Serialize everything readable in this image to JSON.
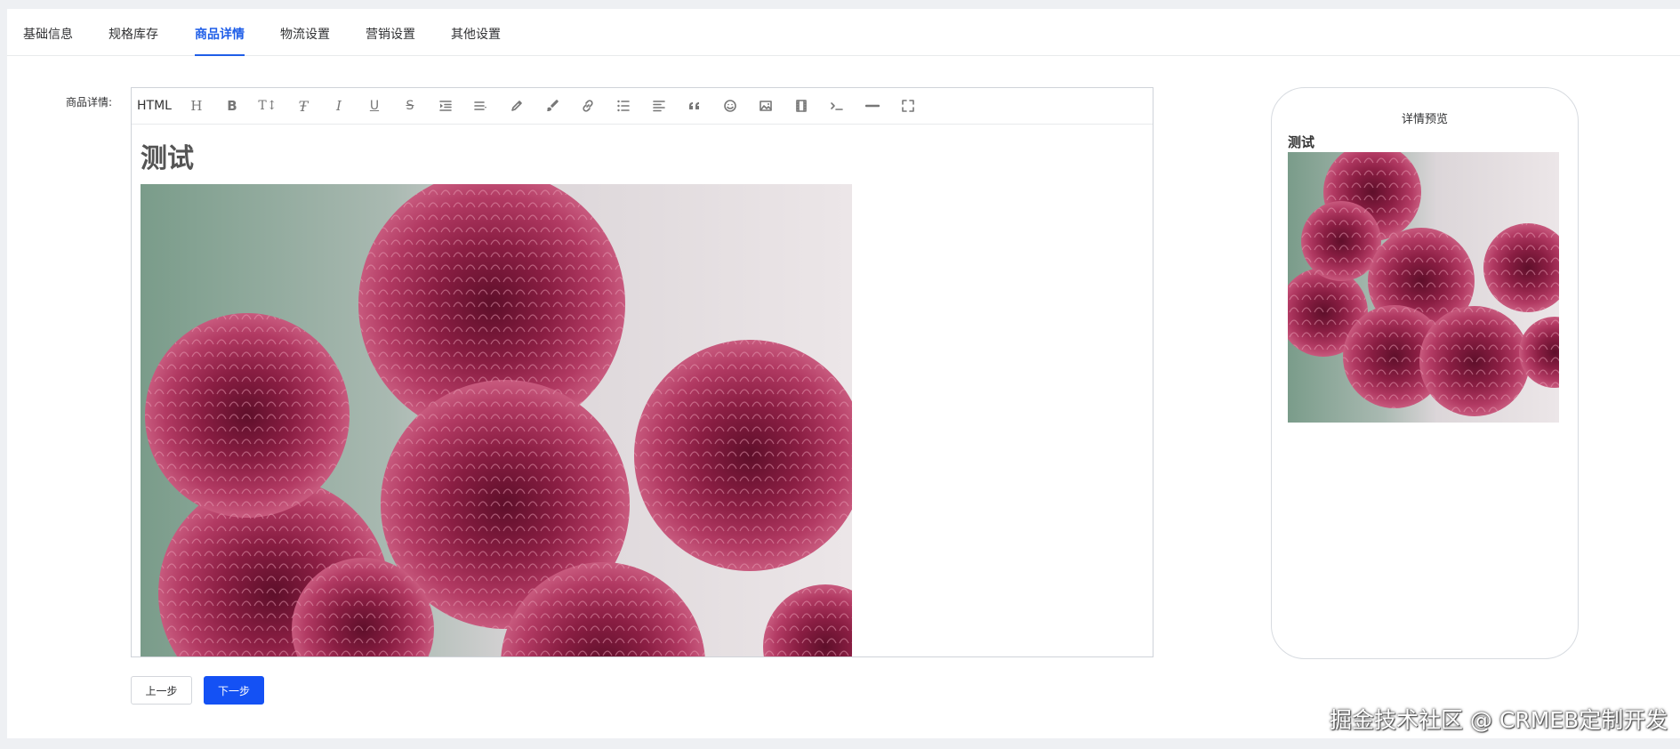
{
  "tabs": [
    {
      "label": "基础信息",
      "active": false
    },
    {
      "label": "规格库存",
      "active": false
    },
    {
      "label": "商品详情",
      "active": true
    },
    {
      "label": "物流设置",
      "active": false
    },
    {
      "label": "营销设置",
      "active": false
    },
    {
      "label": "其他设置",
      "active": false
    }
  ],
  "form": {
    "detail_label": "商品详情:"
  },
  "editor": {
    "html_button": "HTML",
    "toolbar_icons": [
      "heading-icon",
      "bold-icon",
      "font-size-icon",
      "font-family-icon",
      "italic-icon",
      "underline-icon",
      "strikethrough-icon",
      "indent-icon",
      "line-height-icon",
      "text-color-icon",
      "background-color-icon",
      "link-icon",
      "list-icon",
      "justify-icon",
      "quote-icon",
      "emoticon-icon",
      "image-icon",
      "video-icon",
      "code-icon",
      "divider-icon",
      "fullscreen-icon"
    ],
    "content_heading": "测试",
    "content_image": "chrysanthemum-flowers-photo"
  },
  "preview": {
    "title": "详情预览",
    "heading": "测试"
  },
  "buttons": {
    "prev": "上一步",
    "next": "下一步"
  },
  "watermark": "掘金技术社区 @ CRMEB定制开发",
  "colors": {
    "accent": "#1f5ee8",
    "primary_button": "#1451f4",
    "flower": "#a3284f"
  }
}
